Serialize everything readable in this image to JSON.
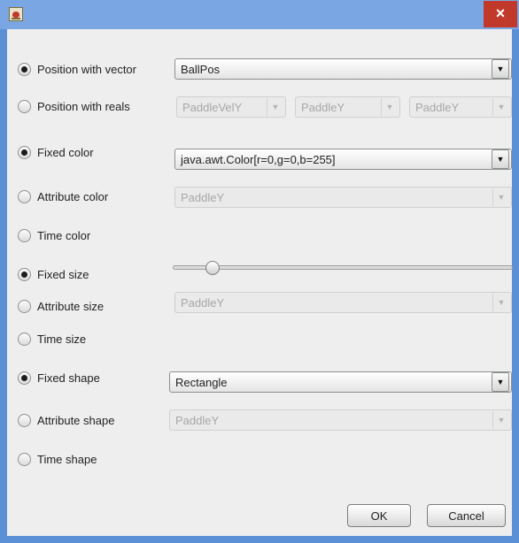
{
  "titlebar": {
    "close_glyph": "×",
    "icon": "java-cup-icon"
  },
  "colors": {
    "title_bg": "#7aa6e3",
    "frame": "#5b8fd6",
    "close_bg": "#c0392b",
    "panel_bg": "#eeeeee"
  },
  "rows": {
    "position_vector": {
      "label": "Position with vector",
      "checked": true,
      "value": "BallPos"
    },
    "position_reals": {
      "label": "Position with reals",
      "checked": false,
      "values": [
        "PaddleVelY",
        "PaddleY",
        "PaddleY"
      ]
    },
    "fixed_color": {
      "label": "Fixed color",
      "checked": true,
      "value": "java.awt.Color[r=0,g=0,b=255]"
    },
    "attribute_color": {
      "label": "Attribute color",
      "checked": false,
      "value": "PaddleY"
    },
    "time_color": {
      "label": "Time color",
      "checked": false
    },
    "fixed_size": {
      "label": "Fixed size",
      "checked": true,
      "slider_fraction": 0.1
    },
    "attribute_size": {
      "label": "Attribute size",
      "checked": false,
      "value": "PaddleY"
    },
    "time_size": {
      "label": "Time size",
      "checked": false
    },
    "fixed_shape": {
      "label": "Fixed shape",
      "checked": true,
      "value": "Rectangle"
    },
    "attribute_shape": {
      "label": "Attribute shape",
      "checked": false,
      "value": "PaddleY"
    },
    "time_shape": {
      "label": "Time shape",
      "checked": false
    }
  },
  "buttons": {
    "ok": "OK",
    "cancel": "Cancel"
  },
  "arrow_glyph": "▼"
}
